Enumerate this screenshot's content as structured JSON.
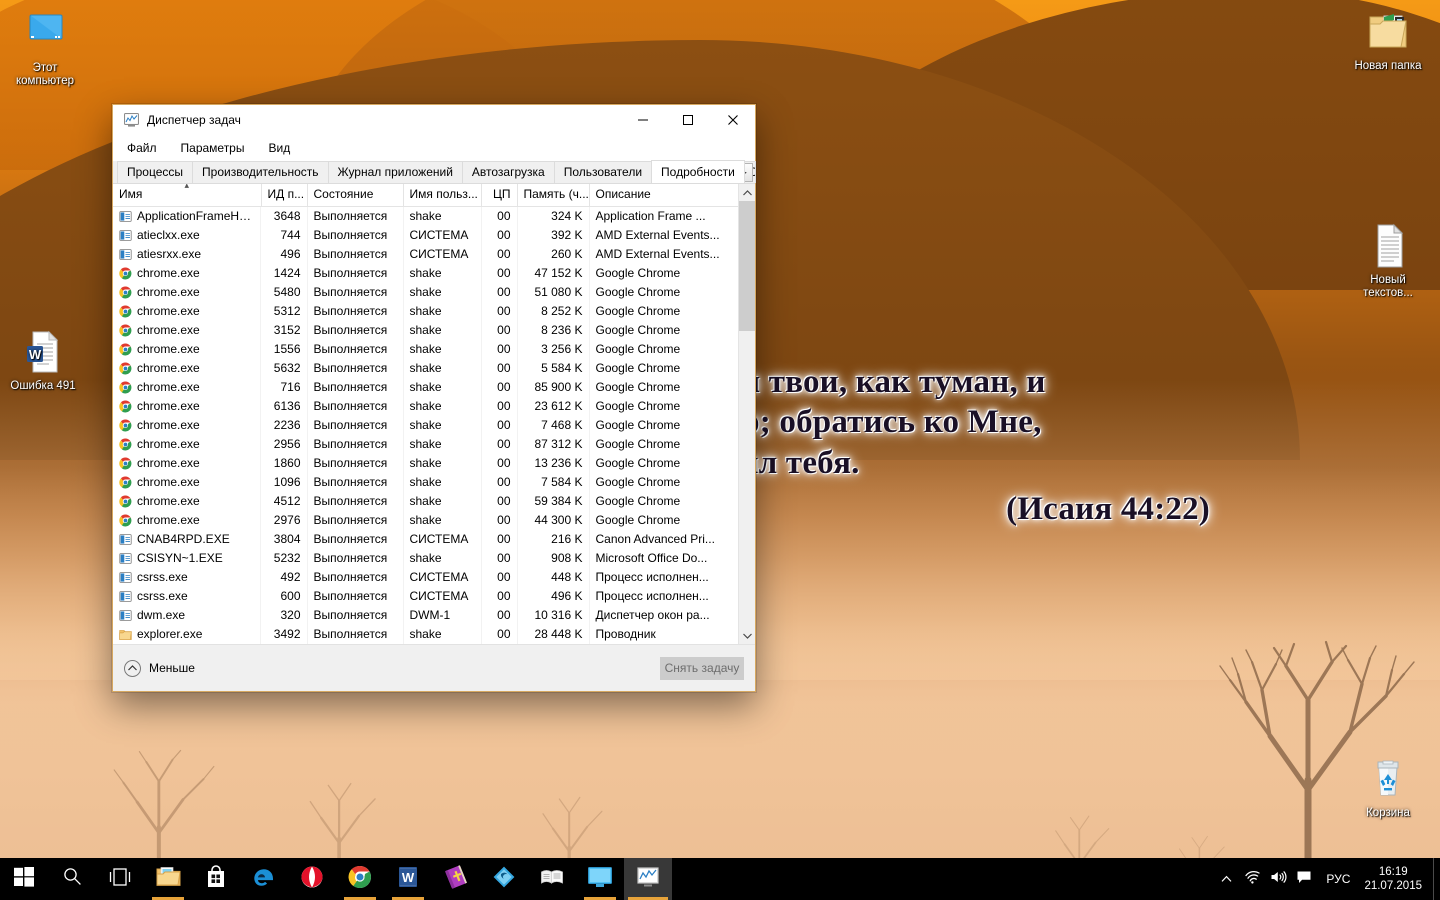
{
  "desktop": {
    "wallpaper_verse": {
      "line1": "…беззакония твои, как туман, и",
      "line2": "…как облако; обратись ко Мне,",
      "line3": "…о Я искупил тебя.",
      "reference": "(Исаия 44:22)"
    },
    "icons": [
      {
        "name": "this-pc",
        "label": "Этот\nкомпьютер",
        "label_l1": "Этот",
        "label_l2": "компьютер",
        "icon": "monitor-icon"
      },
      {
        "name": "word-doc",
        "label": "Ошибка 491",
        "label_l1": "Ошибка 491",
        "label_l2": "",
        "icon": "word-document-icon"
      },
      {
        "name": "new-folder",
        "label": "Новая папка",
        "label_l1": "Новая папка",
        "label_l2": "",
        "icon": "folder-icon"
      },
      {
        "name": "new-text",
        "label": "Новый текстов…",
        "label_l1": "Новый",
        "label_l2": "текстов...",
        "icon": "text-document-icon"
      },
      {
        "name": "recycle-bin",
        "label": "Корзина",
        "label_l1": "Корзина",
        "label_l2": "",
        "icon": "recycle-bin-icon"
      }
    ]
  },
  "task_manager": {
    "title": "Диспетчер задач",
    "title_icon": "task-manager-icon",
    "window_controls": {
      "minimize": "—",
      "maximize": "☐",
      "close": "✕"
    },
    "menu": [
      {
        "label": "Файл"
      },
      {
        "label": "Параметры"
      },
      {
        "label": "Вид"
      }
    ],
    "tabs": [
      {
        "label": "Процессы",
        "active": false
      },
      {
        "label": "Производительность",
        "active": false
      },
      {
        "label": "Журнал приложений",
        "active": false
      },
      {
        "label": "Автозагрузка",
        "active": false
      },
      {
        "label": "Пользователи",
        "active": false
      },
      {
        "label": "Подробности",
        "active": true
      },
      {
        "label": "С.",
        "active": false
      }
    ],
    "tab_scroll": {
      "left": "◄",
      "right": "►"
    },
    "columns": [
      {
        "key": "name",
        "label": "Имя",
        "align": "left",
        "sorted": true
      },
      {
        "key": "pid",
        "label": "ИД п...",
        "align": "right",
        "sorted": false
      },
      {
        "key": "state",
        "label": "Состояние",
        "align": "left",
        "sorted": false
      },
      {
        "key": "user",
        "label": "Имя польз...",
        "align": "left",
        "sorted": false
      },
      {
        "key": "cpu",
        "label": "ЦП",
        "align": "right",
        "sorted": false
      },
      {
        "key": "mem",
        "label": "Память (ч...",
        "align": "right",
        "sorted": false
      },
      {
        "key": "desc",
        "label": "Описание",
        "align": "left",
        "sorted": false
      }
    ],
    "rows": [
      {
        "icon": "app-generic-icon",
        "name": "ApplicationFrameHo...",
        "pid": "3648",
        "state": "Выполняется",
        "user": "shake",
        "cpu": "00",
        "mem": "324 K",
        "desc": "Application Frame ..."
      },
      {
        "icon": "app-generic-icon",
        "name": "atieclxx.exe",
        "pid": "744",
        "state": "Выполняется",
        "user": "СИСТЕМА",
        "cpu": "00",
        "mem": "392 K",
        "desc": "AMD External Events..."
      },
      {
        "icon": "app-generic-icon",
        "name": "atiesrxx.exe",
        "pid": "496",
        "state": "Выполняется",
        "user": "СИСТЕМА",
        "cpu": "00",
        "mem": "260 K",
        "desc": "AMD External Events..."
      },
      {
        "icon": "chrome-icon",
        "name": "chrome.exe",
        "pid": "1424",
        "state": "Выполняется",
        "user": "shake",
        "cpu": "00",
        "mem": "47 152 K",
        "desc": "Google Chrome"
      },
      {
        "icon": "chrome-icon",
        "name": "chrome.exe",
        "pid": "5480",
        "state": "Выполняется",
        "user": "shake",
        "cpu": "00",
        "mem": "51 080 K",
        "desc": "Google Chrome"
      },
      {
        "icon": "chrome-icon",
        "name": "chrome.exe",
        "pid": "5312",
        "state": "Выполняется",
        "user": "shake",
        "cpu": "00",
        "mem": "8 252 K",
        "desc": "Google Chrome"
      },
      {
        "icon": "chrome-icon",
        "name": "chrome.exe",
        "pid": "3152",
        "state": "Выполняется",
        "user": "shake",
        "cpu": "00",
        "mem": "8 236 K",
        "desc": "Google Chrome"
      },
      {
        "icon": "chrome-icon",
        "name": "chrome.exe",
        "pid": "1556",
        "state": "Выполняется",
        "user": "shake",
        "cpu": "00",
        "mem": "3 256 K",
        "desc": "Google Chrome"
      },
      {
        "icon": "chrome-icon",
        "name": "chrome.exe",
        "pid": "5632",
        "state": "Выполняется",
        "user": "shake",
        "cpu": "00",
        "mem": "5 584 K",
        "desc": "Google Chrome"
      },
      {
        "icon": "chrome-icon",
        "name": "chrome.exe",
        "pid": "716",
        "state": "Выполняется",
        "user": "shake",
        "cpu": "00",
        "mem": "85 900 K",
        "desc": "Google Chrome"
      },
      {
        "icon": "chrome-icon",
        "name": "chrome.exe",
        "pid": "6136",
        "state": "Выполняется",
        "user": "shake",
        "cpu": "00",
        "mem": "23 612 K",
        "desc": "Google Chrome"
      },
      {
        "icon": "chrome-icon",
        "name": "chrome.exe",
        "pid": "2236",
        "state": "Выполняется",
        "user": "shake",
        "cpu": "00",
        "mem": "7 468 K",
        "desc": "Google Chrome"
      },
      {
        "icon": "chrome-icon",
        "name": "chrome.exe",
        "pid": "2956",
        "state": "Выполняется",
        "user": "shake",
        "cpu": "00",
        "mem": "87 312 K",
        "desc": "Google Chrome"
      },
      {
        "icon": "chrome-icon",
        "name": "chrome.exe",
        "pid": "1860",
        "state": "Выполняется",
        "user": "shake",
        "cpu": "00",
        "mem": "13 236 K",
        "desc": "Google Chrome"
      },
      {
        "icon": "chrome-icon",
        "name": "chrome.exe",
        "pid": "1096",
        "state": "Выполняется",
        "user": "shake",
        "cpu": "00",
        "mem": "7 584 K",
        "desc": "Google Chrome"
      },
      {
        "icon": "chrome-icon",
        "name": "chrome.exe",
        "pid": "4512",
        "state": "Выполняется",
        "user": "shake",
        "cpu": "00",
        "mem": "59 384 K",
        "desc": "Google Chrome"
      },
      {
        "icon": "chrome-icon",
        "name": "chrome.exe",
        "pid": "2976",
        "state": "Выполняется",
        "user": "shake",
        "cpu": "00",
        "mem": "44 300 K",
        "desc": "Google Chrome"
      },
      {
        "icon": "app-generic-icon",
        "name": "CNAB4RPD.EXE",
        "pid": "3804",
        "state": "Выполняется",
        "user": "СИСТЕМА",
        "cpu": "00",
        "mem": "216 K",
        "desc": "Canon Advanced Pri..."
      },
      {
        "icon": "app-generic-icon",
        "name": "CSISYN~1.EXE",
        "pid": "5232",
        "state": "Выполняется",
        "user": "shake",
        "cpu": "00",
        "mem": "908 K",
        "desc": "Microsoft Office Do..."
      },
      {
        "icon": "app-generic-icon",
        "name": "csrss.exe",
        "pid": "492",
        "state": "Выполняется",
        "user": "СИСТЕМА",
        "cpu": "00",
        "mem": "448 K",
        "desc": "Процесс исполнен..."
      },
      {
        "icon": "app-generic-icon",
        "name": "csrss.exe",
        "pid": "600",
        "state": "Выполняется",
        "user": "СИСТЕМА",
        "cpu": "00",
        "mem": "496 K",
        "desc": "Процесс исполнен..."
      },
      {
        "icon": "app-generic-icon",
        "name": "dwm.exe",
        "pid": "320",
        "state": "Выполняется",
        "user": "DWM-1",
        "cpu": "00",
        "mem": "10 316 K",
        "desc": "Диспетчер окон ра..."
      },
      {
        "icon": "folder-icon",
        "name": "explorer.exe",
        "pid": "3492",
        "state": "Выполняется",
        "user": "shake",
        "cpu": "00",
        "mem": "28 448 K",
        "desc": "Проводник"
      }
    ],
    "footer": {
      "less_label": "Меньше",
      "less_icon": "chevron-up-circle-icon",
      "end_task_label": "Снять задачу"
    }
  },
  "taskbar": {
    "start_icon": "windows-start-icon",
    "items": [
      {
        "name": "start",
        "icon": "windows-start-icon",
        "running": false,
        "active": false
      },
      {
        "name": "search",
        "icon": "search-icon",
        "running": false,
        "active": false
      },
      {
        "name": "task-view",
        "icon": "task-view-icon",
        "running": false,
        "active": false
      },
      {
        "name": "file-explorer",
        "icon": "folder-icon",
        "running": true,
        "active": false
      },
      {
        "name": "store",
        "icon": "store-bag-icon",
        "running": false,
        "active": false
      },
      {
        "name": "edge",
        "icon": "edge-icon",
        "running": false,
        "active": false
      },
      {
        "name": "yandex",
        "icon": "yandex-browser-icon",
        "running": false,
        "active": false
      },
      {
        "name": "chrome",
        "icon": "chrome-icon",
        "running": true,
        "active": false
      },
      {
        "name": "word",
        "icon": "word-icon",
        "running": true,
        "active": false
      },
      {
        "name": "bible",
        "icon": "bible-book-icon",
        "running": false,
        "active": false
      },
      {
        "name": "diamond-app",
        "icon": "blue-diamond-icon",
        "running": false,
        "active": false
      },
      {
        "name": "notes-app",
        "icon": "open-book-icon",
        "running": false,
        "active": false
      },
      {
        "name": "remote-desktop",
        "icon": "monitor-icon",
        "running": true,
        "active": false
      },
      {
        "name": "task-manager",
        "icon": "task-manager-icon",
        "running": true,
        "active": true
      }
    ],
    "tray": {
      "show_hidden_icon": "chevron-up-icon",
      "network_icon": "wifi-icon",
      "volume_icon": "speaker-icon",
      "action_center_icon": "action-center-icon",
      "language": "РУС",
      "time": "16:19",
      "date": "21.07.2015"
    }
  },
  "colors": {
    "accent_orange": "#e7a33a",
    "taskbar": "#000000",
    "window_bg": "#f0f0f0",
    "table_bg": "#ffffff",
    "disabled_button": "#cccccc",
    "window_border": "#d7a860"
  }
}
